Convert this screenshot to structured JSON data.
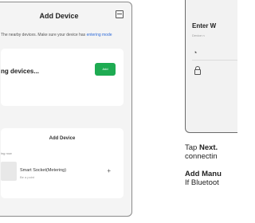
{
  "left_screen": {
    "title": "Add Device",
    "description": "The nearby devices. Make sure your device has",
    "description_link": "entering mode",
    "searching_label": "ng devices...",
    "add_button": "Add",
    "section_title": "Add Device",
    "section_sub": "ing now",
    "device_name": "Smart Socket(Metering)",
    "device_sub": "Be a point"
  },
  "right_screen": {
    "title": "Enter W",
    "subtitle": "Device n"
  },
  "right_text": {
    "line1_prefix": "Tap ",
    "line1_bold": "Next.",
    "line2": "connectin",
    "line3_bold": "Add Manu",
    "line4": "If Bluetoot"
  }
}
